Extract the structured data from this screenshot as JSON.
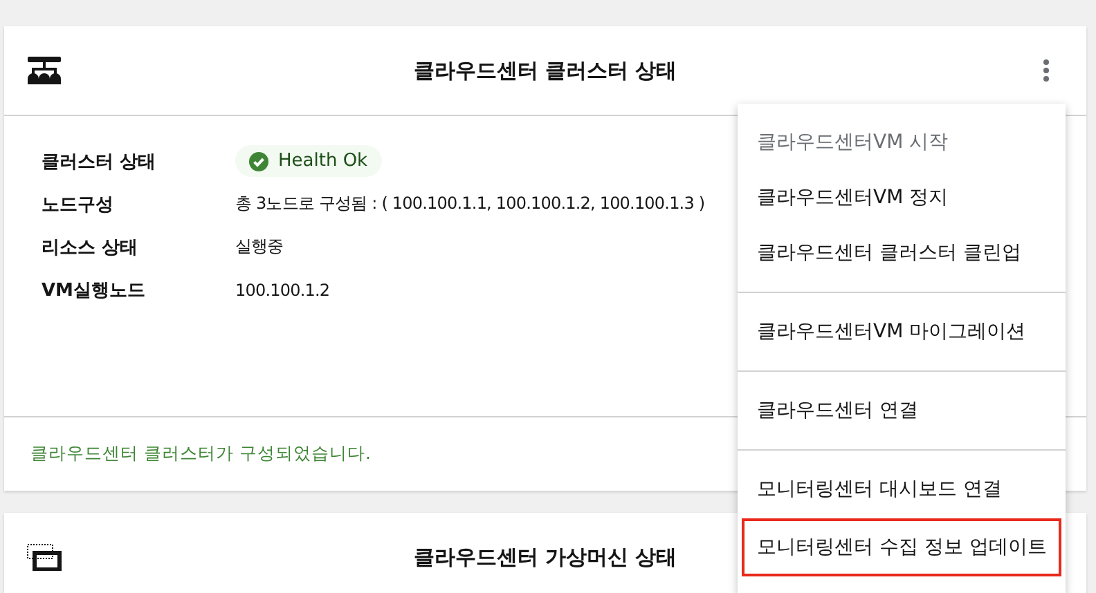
{
  "cards": [
    {
      "title": "클라우드센터 클러스터 상태",
      "fields": [
        {
          "label": "클러스터 상태",
          "kind": "badge",
          "value": "Health Ok"
        },
        {
          "label": "노드구성",
          "kind": "text",
          "value": "총 3노드로 구성됨 : ( 100.100.1.1, 100.100.1.2, 100.100.1.3 )"
        },
        {
          "label": "리소스 상태",
          "kind": "text",
          "value": "실행중"
        },
        {
          "label": "VM실행노드",
          "kind": "text",
          "value": "100.100.1.2"
        }
      ],
      "footer": "클라우드센터 클러스터가 구성되었습니다."
    },
    {
      "title": "클라우드센터 가상머신 상태"
    }
  ],
  "menu": {
    "groups": [
      [
        {
          "label": "클라우드센터VM 시작",
          "disabled": true,
          "highlighted": false
        },
        {
          "label": "클라우드센터VM 정지",
          "disabled": false,
          "highlighted": false
        },
        {
          "label": "클라우드센터 클러스터 클린업",
          "disabled": false,
          "highlighted": false
        }
      ],
      [
        {
          "label": "클라우드센터VM 마이그레이션",
          "disabled": false,
          "highlighted": false
        }
      ],
      [
        {
          "label": "클라우드센터 연결",
          "disabled": false,
          "highlighted": false
        }
      ],
      [
        {
          "label": "모니터링센터 대시보드 연결",
          "disabled": false,
          "highlighted": false
        },
        {
          "label": "모니터링센터 수집 정보 업데이트",
          "disabled": false,
          "highlighted": true
        }
      ]
    ]
  }
}
